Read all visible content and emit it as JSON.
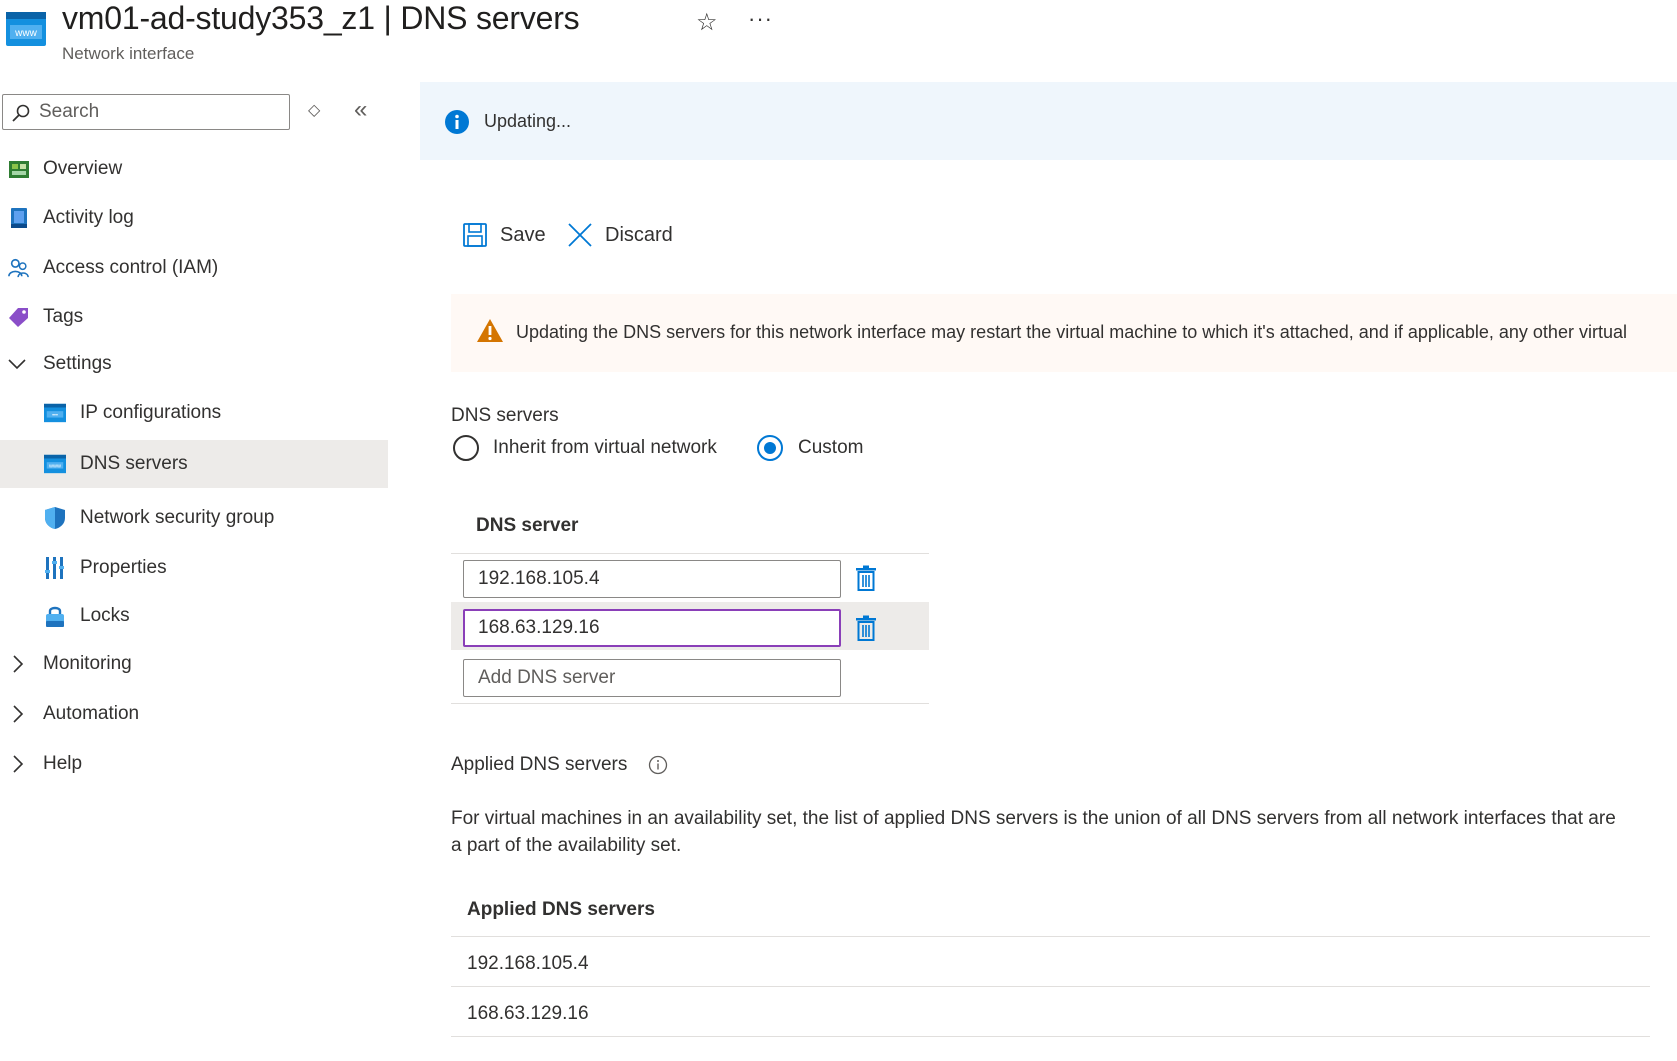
{
  "header": {
    "title": "vm01-ad-study353_z1 | DNS servers",
    "subtitle": "Network interface",
    "favorite_icon": "star-icon",
    "more_label": "···"
  },
  "sidebar": {
    "search_placeholder": "Search",
    "items": [
      {
        "label": "Overview",
        "icon": "overview-icon"
      },
      {
        "label": "Activity log",
        "icon": "activity-log-icon"
      },
      {
        "label": "Access control (IAM)",
        "icon": "iam-icon"
      },
      {
        "label": "Tags",
        "icon": "tag-icon"
      },
      {
        "label": "Settings",
        "icon": "chevron-down-icon",
        "expanded": true
      },
      {
        "label": "IP configurations",
        "icon": "ip-config-icon"
      },
      {
        "label": "DNS servers",
        "icon": "dns-icon",
        "selected": true
      },
      {
        "label": "Network security group",
        "icon": "shield-icon"
      },
      {
        "label": "Properties",
        "icon": "properties-icon"
      },
      {
        "label": "Locks",
        "icon": "lock-icon"
      },
      {
        "label": "Monitoring",
        "icon": "chevron-right-icon"
      },
      {
        "label": "Automation",
        "icon": "chevron-right-icon"
      },
      {
        "label": "Help",
        "icon": "chevron-right-icon"
      }
    ]
  },
  "main": {
    "updating_text": "Updating...",
    "toolbar": {
      "save_label": "Save",
      "discard_label": "Discard"
    },
    "warning_text": "Updating the DNS servers for this network interface may restart the virtual machine to which it's attached, and if applicable, any other virtual",
    "dns_section_label": "DNS servers",
    "radio_inherit_label": "Inherit from virtual network",
    "radio_custom_label": "Custom",
    "selected_radio": "Custom",
    "dns_table_header": "DNS server",
    "dns_servers": [
      "192.168.105.4",
      "168.63.129.16"
    ],
    "add_placeholder": "Add DNS server",
    "applied_label": "Applied DNS servers",
    "applied_description": "For virtual machines in an availability set, the list of applied DNS servers is the union of all DNS servers from all network interfaces that are a part of the availability set.",
    "applied_table_header": "Applied DNS servers",
    "applied_servers": [
      "192.168.105.4",
      "168.63.129.16"
    ]
  },
  "colors": {
    "accent": "#0078d4",
    "selected_bg": "#edebe9",
    "info_bar": "#eff6fc",
    "warning_bar": "#fff9f5",
    "focus_border": "#8a3fb8",
    "warning_icon": "#d47500"
  }
}
